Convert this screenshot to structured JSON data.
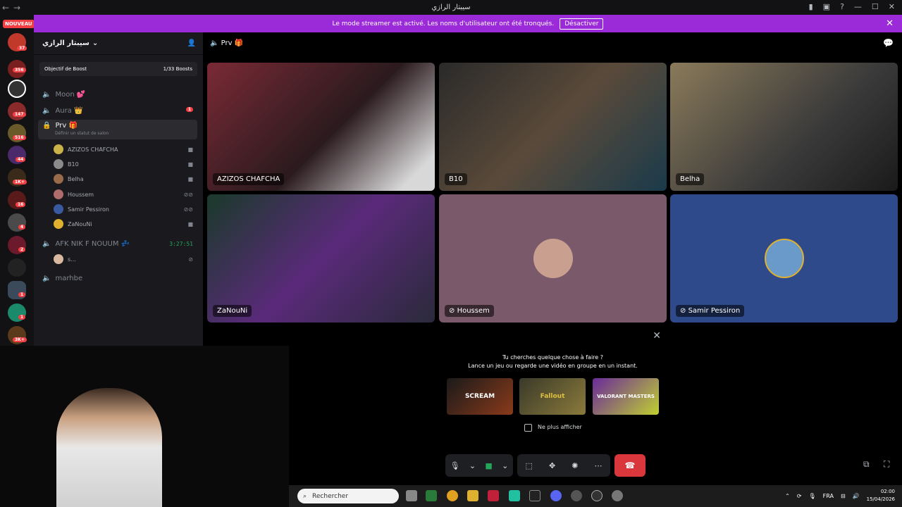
{
  "window": {
    "title": "سيبتار الرازي"
  },
  "banner": {
    "text": "Le mode streamer est activé. Les noms d'utilisateur ont été tronqués.",
    "button": "Désactiver"
  },
  "rail": {
    "new_label": "NOUVEAU",
    "badges": [
      "37",
      "356",
      "147",
      "516",
      "44",
      "1K+",
      "16",
      "4",
      "2",
      "1",
      "1",
      "3K+"
    ]
  },
  "server": {
    "name": "سيبتار الرازي",
    "boost_label": "Objectif de Boost",
    "boost_count": "1/33 Boosts"
  },
  "channels": [
    {
      "name": "Moon 💕"
    },
    {
      "name": "Aura 👑",
      "badge": "1"
    },
    {
      "name": "Prv 🎁",
      "status": "Définir un statut de salon"
    },
    {
      "name": "AFK NIK F NOUUM 💤",
      "timer": "3:27:51"
    },
    {
      "name": "marhbe"
    }
  ],
  "members": [
    {
      "name": "AZIZOS CHAFCHA",
      "icon": "video-icon",
      "color": "#c9b24a"
    },
    {
      "name": "B10",
      "icon": "video-icon",
      "color": "#8a8a8a"
    },
    {
      "name": "Belha",
      "icon": "video-icon",
      "color": "#9a6b4a"
    },
    {
      "name": "Houssem",
      "icon": "deafened-icon",
      "color": "#b06b6b"
    },
    {
      "name": "Samir Pessiron",
      "icon": "deafened-icon",
      "color": "#3a5aa0"
    },
    {
      "name": "ZaNouNi",
      "icon": "video-icon",
      "color": "#e0b030"
    }
  ],
  "afk_member": {
    "name": "s..."
  },
  "voice": {
    "channel_title": "Prv 🎁"
  },
  "tiles": [
    {
      "name": "AZIZOS CHAFCHA",
      "bg": "#5a2a2e"
    },
    {
      "name": "B10",
      "bg": "#3a3530"
    },
    {
      "name": "Belha",
      "bg": "#4a3a2a"
    },
    {
      "name": "ZaNouNi",
      "bg": "#3a2050"
    },
    {
      "name": "Houssem",
      "bg": "#7a5a6a"
    },
    {
      "name": "Samir Pessiron",
      "bg": "#2e4a8a"
    }
  ],
  "activity": {
    "line1": "Tu cherches quelque chose à faire ?",
    "line2": "Lance un jeu ou regarde une vidéo en groupe en un instant.",
    "games": [
      "SCREAM",
      "Fallout",
      "VALORANT MASTERS"
    ],
    "checkbox": "Ne plus afficher"
  },
  "taskbar": {
    "search_placeholder": "Rechercher",
    "lang": "FRA",
    "time": "02:00",
    "date": "15/04/2026"
  }
}
